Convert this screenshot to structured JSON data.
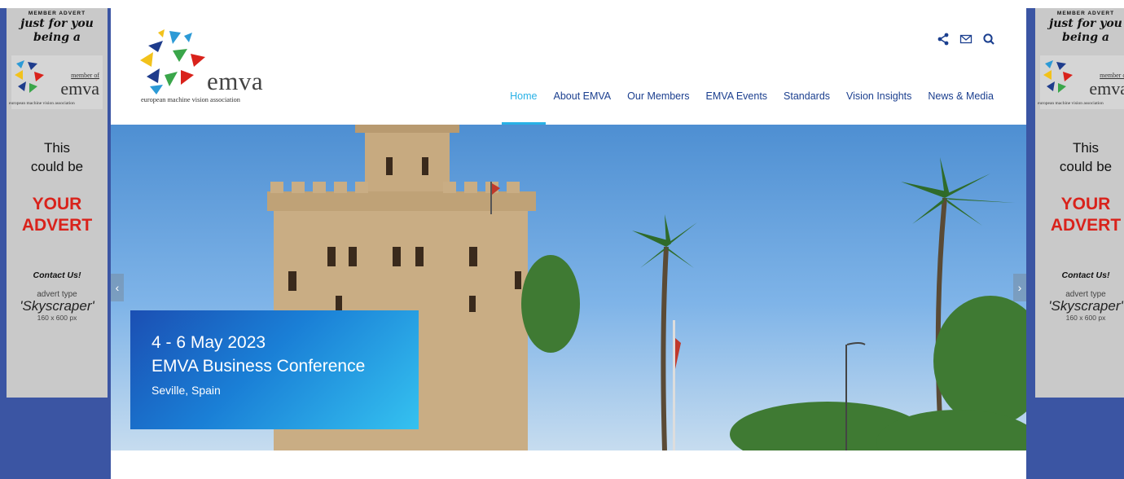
{
  "header": {
    "logo_word": "emva",
    "logo_tagline": "european machine vision association",
    "icons": [
      "share-icon",
      "mail-icon",
      "search-icon"
    ]
  },
  "nav": [
    {
      "label": "Home",
      "active": true
    },
    {
      "label": "About EMVA",
      "active": false
    },
    {
      "label": "Our Members",
      "active": false
    },
    {
      "label": "EMVA Events",
      "active": false
    },
    {
      "label": "Standards",
      "active": false
    },
    {
      "label": "Vision Insights",
      "active": false
    },
    {
      "label": "News & Media",
      "active": false
    }
  ],
  "hero": {
    "date": "4 - 6 May 2023",
    "title": "EMVA Business Conference",
    "location": "Seville, Spain",
    "prev_arrow": "‹",
    "next_arrow": "›"
  },
  "ad": {
    "header": "MEMBER ADVERT",
    "script_line1": "just for you",
    "script_line2": "being a",
    "member_of": "member of",
    "emva": "emva",
    "tagline": "european machine vision association",
    "this": "This",
    "could_be": "could be",
    "your": "YOUR",
    "advert": "ADVERT",
    "contact": "Contact Us!",
    "advert_type": "advert type",
    "skyscraper": "'Skyscraper'",
    "size": "160 x 600 px"
  },
  "colors": {
    "nav_text": "#1b3f8f",
    "nav_active": "#28b1e6",
    "side_band": "#3b55a3",
    "ad_red": "#d9221b"
  }
}
